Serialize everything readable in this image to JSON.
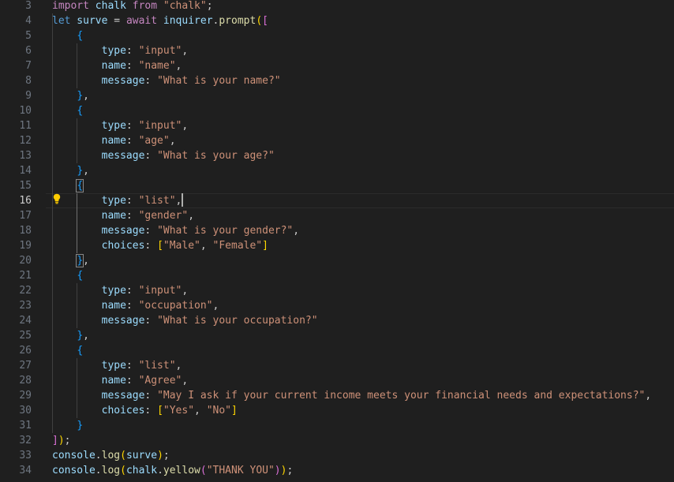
{
  "editor": {
    "active_line": 16,
    "lines": [
      {
        "n": "3",
        "tokens": [
          {
            "t": "import",
            "c": "kw"
          },
          {
            "t": " chalk ",
            "c": "var"
          },
          {
            "t": "from",
            "c": "kw"
          },
          {
            "t": " ",
            "c": "pl"
          },
          {
            "t": "\"chalk\"",
            "c": "str"
          },
          {
            "t": ";",
            "c": "pl"
          }
        ]
      },
      {
        "n": "4",
        "tokens": [
          {
            "t": "let",
            "c": "dec"
          },
          {
            "t": " surve ",
            "c": "var"
          },
          {
            "t": "= ",
            "c": "pl"
          },
          {
            "t": "await",
            "c": "kw"
          },
          {
            "t": " inquirer",
            "c": "var"
          },
          {
            "t": ".",
            "c": "pl"
          },
          {
            "t": "prompt",
            "c": "fn"
          },
          {
            "t": "(",
            "c": "b1"
          },
          {
            "t": "[",
            "c": "b2"
          }
        ]
      },
      {
        "n": "5",
        "tokens": [
          {
            "t": "    ",
            "c": "pl"
          },
          {
            "t": "{",
            "c": "b3"
          }
        ]
      },
      {
        "n": "6",
        "tokens": [
          {
            "t": "        type",
            "c": "var"
          },
          {
            "t": ": ",
            "c": "pl"
          },
          {
            "t": "\"input\"",
            "c": "str"
          },
          {
            "t": ",",
            "c": "pl"
          }
        ]
      },
      {
        "n": "7",
        "tokens": [
          {
            "t": "        name",
            "c": "var"
          },
          {
            "t": ": ",
            "c": "pl"
          },
          {
            "t": "\"name\"",
            "c": "str"
          },
          {
            "t": ",",
            "c": "pl"
          }
        ]
      },
      {
        "n": "8",
        "tokens": [
          {
            "t": "        message",
            "c": "var"
          },
          {
            "t": ": ",
            "c": "pl"
          },
          {
            "t": "\"What is your name?\"",
            "c": "str"
          }
        ]
      },
      {
        "n": "9",
        "tokens": [
          {
            "t": "    ",
            "c": "pl"
          },
          {
            "t": "}",
            "c": "b3"
          },
          {
            "t": ",",
            "c": "pl"
          }
        ]
      },
      {
        "n": "10",
        "tokens": [
          {
            "t": "    ",
            "c": "pl"
          },
          {
            "t": "{",
            "c": "b3"
          }
        ]
      },
      {
        "n": "11",
        "tokens": [
          {
            "t": "        type",
            "c": "var"
          },
          {
            "t": ": ",
            "c": "pl"
          },
          {
            "t": "\"input\"",
            "c": "str"
          },
          {
            "t": ",",
            "c": "pl"
          }
        ]
      },
      {
        "n": "12",
        "tokens": [
          {
            "t": "        name",
            "c": "var"
          },
          {
            "t": ": ",
            "c": "pl"
          },
          {
            "t": "\"age\"",
            "c": "str"
          },
          {
            "t": ",",
            "c": "pl"
          }
        ]
      },
      {
        "n": "13",
        "tokens": [
          {
            "t": "        message",
            "c": "var"
          },
          {
            "t": ": ",
            "c": "pl"
          },
          {
            "t": "\"What is your age?\"",
            "c": "str"
          }
        ]
      },
      {
        "n": "14",
        "tokens": [
          {
            "t": "    ",
            "c": "pl"
          },
          {
            "t": "}",
            "c": "b3"
          },
          {
            "t": ",",
            "c": "pl"
          }
        ]
      },
      {
        "n": "15",
        "tokens": [
          {
            "t": "    ",
            "c": "pl"
          },
          {
            "t": "{",
            "c": "b3",
            "bm": true
          }
        ]
      },
      {
        "n": "16",
        "tokens": [
          {
            "t": "        type",
            "c": "var"
          },
          {
            "t": ": ",
            "c": "pl"
          },
          {
            "t": "\"list\"",
            "c": "str"
          },
          {
            "t": ",",
            "c": "pl"
          }
        ],
        "cursor": true
      },
      {
        "n": "17",
        "tokens": [
          {
            "t": "        name",
            "c": "var"
          },
          {
            "t": ": ",
            "c": "pl"
          },
          {
            "t": "\"gender\"",
            "c": "str"
          },
          {
            "t": ",",
            "c": "pl"
          }
        ]
      },
      {
        "n": "18",
        "tokens": [
          {
            "t": "        message",
            "c": "var"
          },
          {
            "t": ": ",
            "c": "pl"
          },
          {
            "t": "\"What is your gender?\"",
            "c": "str"
          },
          {
            "t": ",",
            "c": "pl"
          }
        ]
      },
      {
        "n": "19",
        "tokens": [
          {
            "t": "        choices",
            "c": "var"
          },
          {
            "t": ": ",
            "c": "pl"
          },
          {
            "t": "[",
            "c": "b1"
          },
          {
            "t": "\"Male\"",
            "c": "str"
          },
          {
            "t": ", ",
            "c": "pl"
          },
          {
            "t": "\"Female\"",
            "c": "str"
          },
          {
            "t": "]",
            "c": "b1"
          }
        ]
      },
      {
        "n": "20",
        "tokens": [
          {
            "t": "    ",
            "c": "pl"
          },
          {
            "t": "}",
            "c": "b3",
            "bm": true
          },
          {
            "t": ",",
            "c": "pl"
          }
        ]
      },
      {
        "n": "21",
        "tokens": [
          {
            "t": "    ",
            "c": "pl"
          },
          {
            "t": "{",
            "c": "b3"
          }
        ]
      },
      {
        "n": "22",
        "tokens": [
          {
            "t": "        type",
            "c": "var"
          },
          {
            "t": ": ",
            "c": "pl"
          },
          {
            "t": "\"input\"",
            "c": "str"
          },
          {
            "t": ",",
            "c": "pl"
          }
        ]
      },
      {
        "n": "23",
        "tokens": [
          {
            "t": "        name",
            "c": "var"
          },
          {
            "t": ": ",
            "c": "pl"
          },
          {
            "t": "\"occupation\"",
            "c": "str"
          },
          {
            "t": ",",
            "c": "pl"
          }
        ]
      },
      {
        "n": "24",
        "tokens": [
          {
            "t": "        message",
            "c": "var"
          },
          {
            "t": ": ",
            "c": "pl"
          },
          {
            "t": "\"What is your occupation?\"",
            "c": "str"
          }
        ]
      },
      {
        "n": "25",
        "tokens": [
          {
            "t": "    ",
            "c": "pl"
          },
          {
            "t": "}",
            "c": "b3"
          },
          {
            "t": ",",
            "c": "pl"
          }
        ]
      },
      {
        "n": "26",
        "tokens": [
          {
            "t": "    ",
            "c": "pl"
          },
          {
            "t": "{",
            "c": "b3"
          }
        ]
      },
      {
        "n": "27",
        "tokens": [
          {
            "t": "        type",
            "c": "var"
          },
          {
            "t": ": ",
            "c": "pl"
          },
          {
            "t": "\"list\"",
            "c": "str"
          },
          {
            "t": ",",
            "c": "pl"
          }
        ]
      },
      {
        "n": "28",
        "tokens": [
          {
            "t": "        name",
            "c": "var"
          },
          {
            "t": ": ",
            "c": "pl"
          },
          {
            "t": "\"Agree\"",
            "c": "str"
          },
          {
            "t": ",",
            "c": "pl"
          }
        ]
      },
      {
        "n": "29",
        "tokens": [
          {
            "t": "        message",
            "c": "var"
          },
          {
            "t": ": ",
            "c": "pl"
          },
          {
            "t": "\"May I ask if your current income meets your financial needs and expectations?\"",
            "c": "str"
          },
          {
            "t": ",",
            "c": "pl"
          }
        ]
      },
      {
        "n": "30",
        "tokens": [
          {
            "t": "        choices",
            "c": "var"
          },
          {
            "t": ": ",
            "c": "pl"
          },
          {
            "t": "[",
            "c": "b1"
          },
          {
            "t": "\"Yes\"",
            "c": "str"
          },
          {
            "t": ", ",
            "c": "pl"
          },
          {
            "t": "\"No\"",
            "c": "str"
          },
          {
            "t": "]",
            "c": "b1"
          }
        ]
      },
      {
        "n": "31",
        "tokens": [
          {
            "t": "    ",
            "c": "pl"
          },
          {
            "t": "}",
            "c": "b3"
          }
        ]
      },
      {
        "n": "32",
        "tokens": [
          {
            "t": "]",
            "c": "b2"
          },
          {
            "t": ")",
            "c": "b1"
          },
          {
            "t": ";",
            "c": "pl"
          }
        ]
      },
      {
        "n": "33",
        "tokens": [
          {
            "t": "console",
            "c": "var"
          },
          {
            "t": ".",
            "c": "pl"
          },
          {
            "t": "log",
            "c": "fn"
          },
          {
            "t": "(",
            "c": "b1"
          },
          {
            "t": "surve",
            "c": "var"
          },
          {
            "t": ")",
            "c": "b1"
          },
          {
            "t": ";",
            "c": "pl"
          }
        ]
      },
      {
        "n": "34",
        "tokens": [
          {
            "t": "console",
            "c": "var"
          },
          {
            "t": ".",
            "c": "pl"
          },
          {
            "t": "log",
            "c": "fn"
          },
          {
            "t": "(",
            "c": "b1"
          },
          {
            "t": "chalk",
            "c": "var"
          },
          {
            "t": ".",
            "c": "pl"
          },
          {
            "t": "yellow",
            "c": "fn"
          },
          {
            "t": "(",
            "c": "b2"
          },
          {
            "t": "\"THANK YOU\"",
            "c": "str"
          },
          {
            "t": ")",
            "c": "b2"
          },
          {
            "t": ")",
            "c": "b1"
          },
          {
            "t": ";",
            "c": "pl"
          }
        ]
      }
    ]
  },
  "colors": {
    "background": "#1f1f1f",
    "keyword": "#c586c0",
    "declaration": "#569cd6",
    "variable": "#9cdcfe",
    "string": "#ce9178",
    "function": "#dcdcaa",
    "bracket_gold": "#ffd700",
    "bracket_orchid": "#da70d6",
    "bracket_blue": "#179fff",
    "line_number": "#6e7681"
  },
  "icons": {
    "lightbulb": "lightbulb-icon"
  }
}
